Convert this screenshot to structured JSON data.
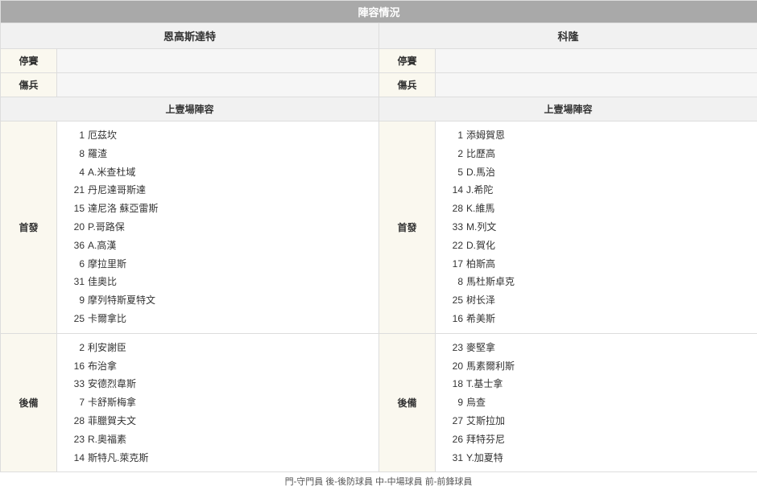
{
  "title": "陣容情況",
  "teams": {
    "home": "恩高斯達特",
    "away": "科隆"
  },
  "rowLabels": {
    "suspended": "停賽",
    "injured": "傷兵",
    "section": "上壹場陣容",
    "starters": "首發",
    "subs": "後備"
  },
  "footer": "門-守門員 後-後防球員 中-中場球員 前-前鋒球員",
  "lineup": {
    "home": {
      "starters": [
        {
          "num": "1",
          "name": "厄茲坎"
        },
        {
          "num": "8",
          "name": "羅渣"
        },
        {
          "num": "4",
          "name": "A.米查杜域"
        },
        {
          "num": "21",
          "name": "丹尼達哥斯達"
        },
        {
          "num": "15",
          "name": "達尼洛 蘇亞雷斯"
        },
        {
          "num": "20",
          "name": "P.哥路保"
        },
        {
          "num": "36",
          "name": "A.高漢"
        },
        {
          "num": "6",
          "name": "摩拉里斯"
        },
        {
          "num": "31",
          "name": "佳奧比"
        },
        {
          "num": "9",
          "name": "摩列特斯夏特文"
        },
        {
          "num": "25",
          "name": "卡爾拿比"
        }
      ],
      "subs": [
        {
          "num": "2",
          "name": "利安謝臣"
        },
        {
          "num": "16",
          "name": "布治拿"
        },
        {
          "num": "33",
          "name": "安德烈韋斯"
        },
        {
          "num": "7",
          "name": "卡舒斯梅拿"
        },
        {
          "num": "28",
          "name": "菲臘賀夫文"
        },
        {
          "num": "23",
          "name": "R.奧福素"
        },
        {
          "num": "14",
          "name": "斯特凡.萊克斯"
        }
      ]
    },
    "away": {
      "starters": [
        {
          "num": "1",
          "name": "添姆賀恩"
        },
        {
          "num": "2",
          "name": "比歷高"
        },
        {
          "num": "5",
          "name": "D.馬治"
        },
        {
          "num": "14",
          "name": "J.希陀"
        },
        {
          "num": "28",
          "name": "K.維馬"
        },
        {
          "num": "33",
          "name": "M.列文"
        },
        {
          "num": "22",
          "name": "D.賀化"
        },
        {
          "num": "17",
          "name": "柏斯高"
        },
        {
          "num": "8",
          "name": "馬杜斯卓克"
        },
        {
          "num": "25",
          "name": "树长泽"
        },
        {
          "num": "16",
          "name": "希美斯"
        }
      ],
      "subs": [
        {
          "num": "23",
          "name": "麥堅拿"
        },
        {
          "num": "20",
          "name": "馬素爾利斯"
        },
        {
          "num": "18",
          "name": "T.基士拿"
        },
        {
          "num": "9",
          "name": "烏查"
        },
        {
          "num": "27",
          "name": "艾斯拉加"
        },
        {
          "num": "26",
          "name": "拜特芬尼"
        },
        {
          "num": "31",
          "name": "Y.加夏特"
        }
      ]
    }
  }
}
